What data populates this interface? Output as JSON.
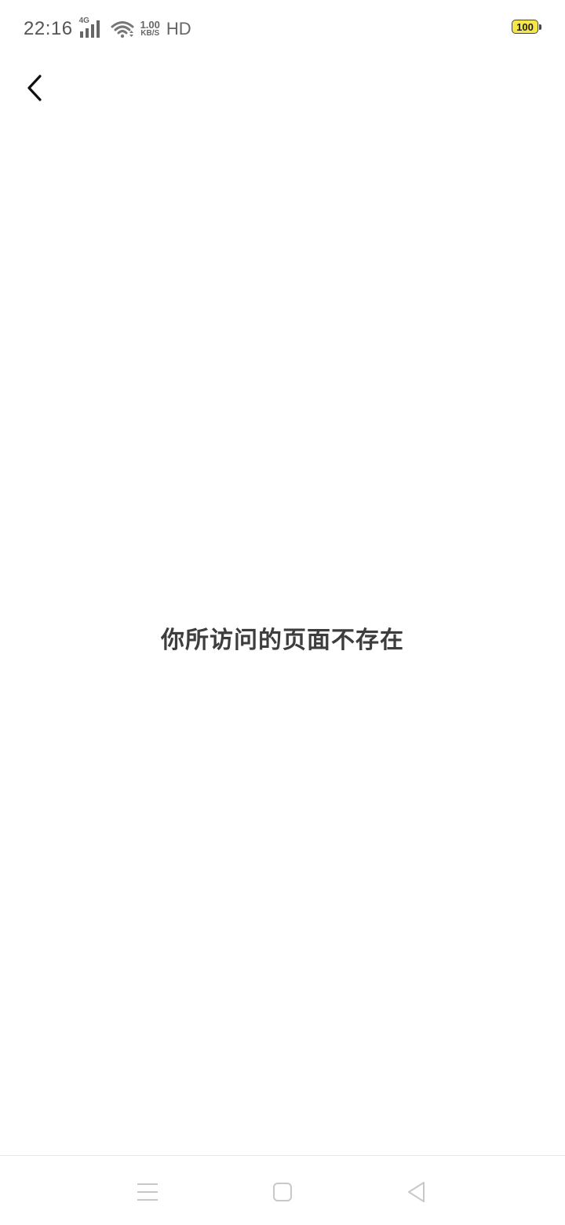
{
  "status_bar": {
    "time": "22:16",
    "network_type": "4G",
    "speed_value": "1.00",
    "speed_unit": "KB/S",
    "hd_label": "HD",
    "battery_level": "100",
    "icons": [
      "signal-icon",
      "wifi-icon",
      "battery-icon"
    ]
  },
  "header": {
    "back_icon": "chevron-left-icon"
  },
  "main": {
    "message": "你所访问的页面不存在"
  },
  "nav_bar": {
    "icons": [
      "menu-icon",
      "home-icon",
      "back-triangle-icon"
    ]
  },
  "colors": {
    "background": "#ffffff",
    "message_text": "#3d3d3d",
    "battery_fill": "#f7e64a",
    "nav_icon": "#c8c8c8"
  }
}
